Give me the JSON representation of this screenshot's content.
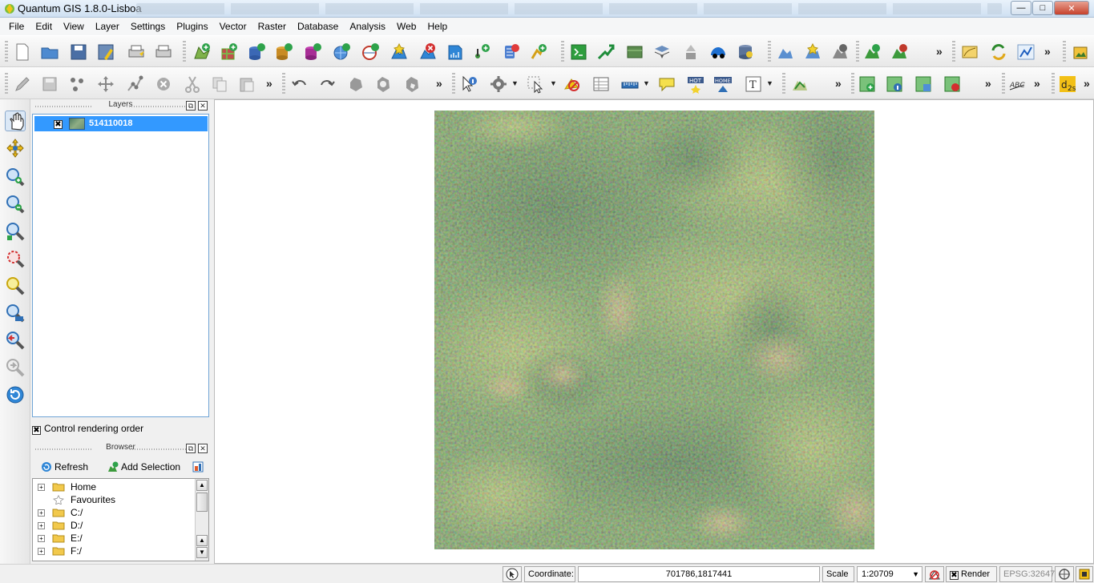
{
  "window": {
    "title": "Quantum GIS 1.8.0-Lisboa",
    "controls": [
      "minimize",
      "maximize",
      "close"
    ]
  },
  "menubar": {
    "items": [
      "File",
      "Edit",
      "View",
      "Layer",
      "Settings",
      "Plugins",
      "Vector",
      "Raster",
      "Database",
      "Analysis",
      "Web",
      "Help"
    ]
  },
  "toolbars": {
    "overflow_symbol": "»"
  },
  "layers_panel": {
    "title": "Layers",
    "layers": [
      {
        "name": "514110018",
        "visible": true,
        "selected": true
      }
    ],
    "control_rendering_order_label": "Control rendering order",
    "control_rendering_order_checked": true
  },
  "browser_panel": {
    "title": "Browser",
    "refresh_label": "Refresh",
    "add_selection_label": "Add Selection",
    "items": [
      {
        "label": "Home",
        "icon": "folder-icon",
        "expandable": true
      },
      {
        "label": "Favourites",
        "icon": "star-icon",
        "expandable": false
      },
      {
        "label": "C:/",
        "icon": "folder-icon",
        "expandable": true
      },
      {
        "label": "D:/",
        "icon": "folder-icon",
        "expandable": true
      },
      {
        "label": "E:/",
        "icon": "folder-icon",
        "expandable": true
      },
      {
        "label": "F:/",
        "icon": "folder-icon",
        "expandable": true
      }
    ]
  },
  "statusbar": {
    "coordinate_label": "Coordinate:",
    "coordinate_value": "701786,1817441",
    "scale_label": "Scale",
    "scale_value": "1:20709",
    "render_label": "Render",
    "render_checked": true,
    "crs": "EPSG:32647"
  },
  "colors": {
    "selection": "#3399ff",
    "panel_border": "#6fa4d6",
    "raster_base": "#5d7f58"
  }
}
